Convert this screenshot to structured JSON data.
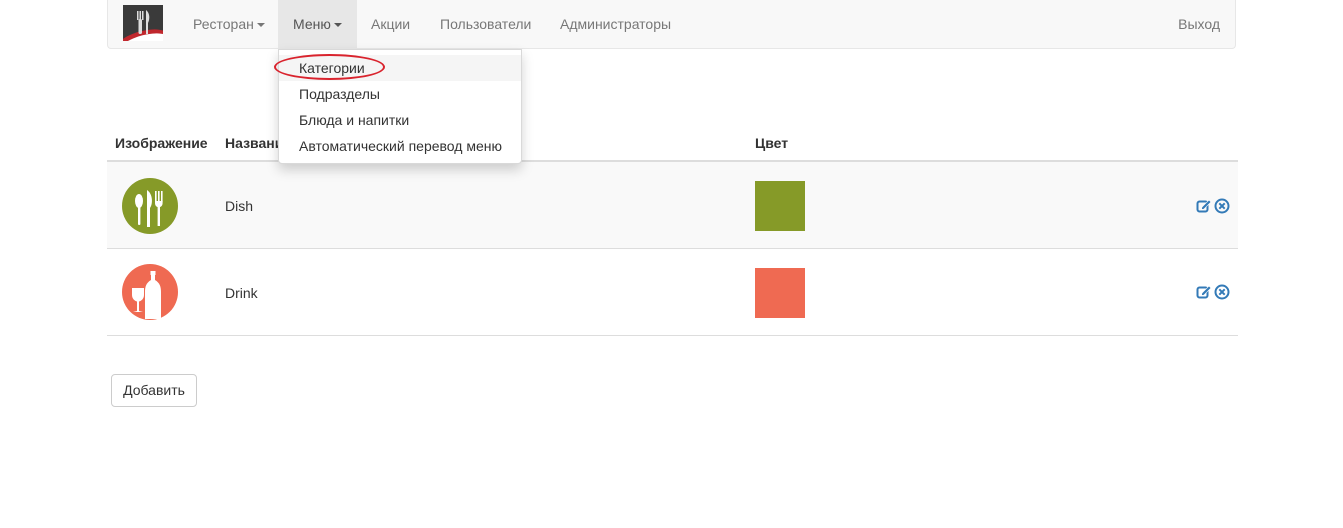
{
  "navbar": {
    "brand_icon": "restaurant-logo-icon",
    "items": [
      {
        "label": "Ресторан",
        "has_caret": true
      },
      {
        "label": "Меню",
        "has_caret": true,
        "active": true
      },
      {
        "label": "Акции"
      },
      {
        "label": "Пользователи"
      },
      {
        "label": "Администраторы"
      }
    ],
    "logout_label": "Выход"
  },
  "dropdown": {
    "items": [
      {
        "label": "Категории",
        "highlighted": true
      },
      {
        "label": "Подразделы"
      },
      {
        "label": "Блюда и напитки"
      },
      {
        "label": "Автоматический перевод меню"
      }
    ]
  },
  "table": {
    "headers": {
      "image": "Изображение",
      "name": "Названи",
      "color": "Цвет"
    },
    "rows": [
      {
        "name": "Dish",
        "icon": "dish-cutlery-icon",
        "color": "#869a28",
        "icon_color": "#869a28"
      },
      {
        "name": "Drink",
        "icon": "drink-bottle-glass-icon",
        "color": "#ef6a52",
        "icon_color": "#ef6a52"
      }
    ],
    "action_icons": [
      "edit-icon",
      "delete-icon"
    ]
  },
  "add_button_label": "Добавить",
  "colors": {
    "accent": "#337ab7",
    "highlight_ring": "#d9232d"
  }
}
